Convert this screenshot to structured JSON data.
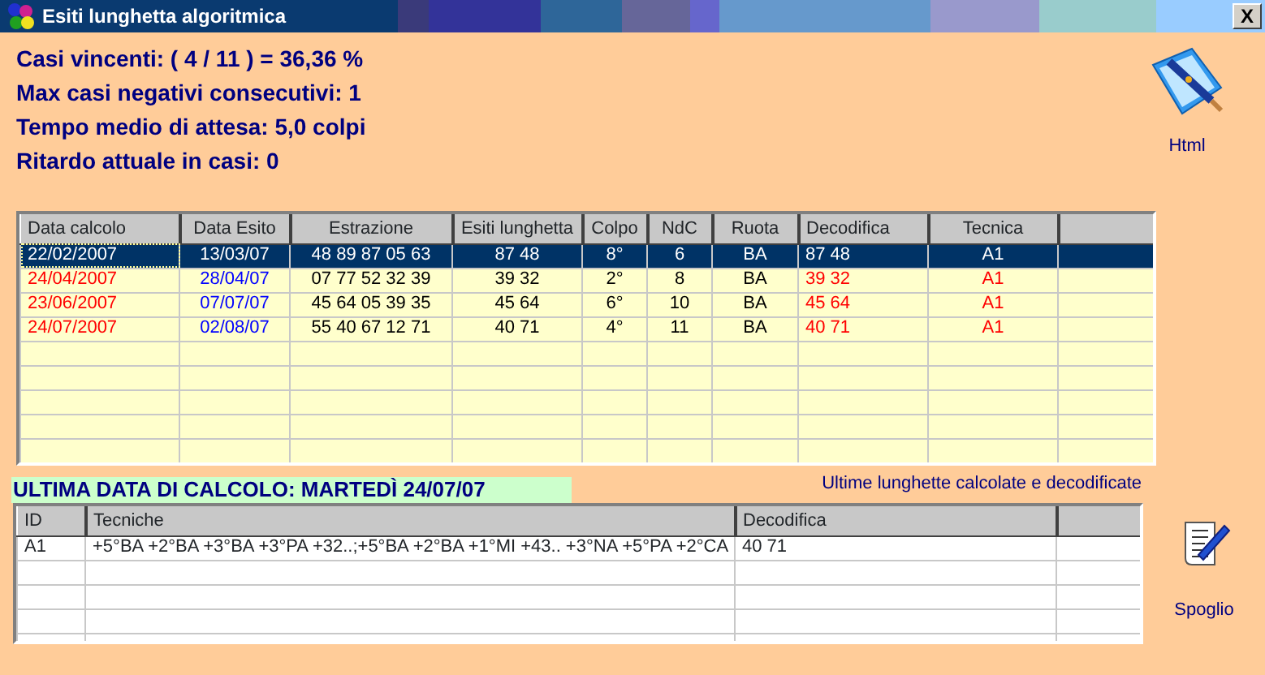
{
  "window": {
    "title": "Esiti lunghetta algoritmica",
    "close": "X"
  },
  "stats": [
    "Casi vincenti: ( 4 / 11 ) = 36,36 %",
    "Max casi negativi consecutivi: 1",
    "Tempo medio di attesa: 5,0 colpi",
    "Ritardo attuale in casi: 0"
  ],
  "html_button": {
    "label": "Html"
  },
  "results_table": {
    "columns": [
      {
        "label": "Data calcolo",
        "color": "#ff0000"
      },
      {
        "label": "Data Esito",
        "color": "#0000ff"
      },
      {
        "label": "Estrazione",
        "color": "#000000"
      },
      {
        "label": "Esiti lunghetta",
        "color": "#000000"
      },
      {
        "label": "Colpo",
        "color": "#000000"
      },
      {
        "label": "NdC",
        "color": "#000000"
      },
      {
        "label": "Ruota",
        "color": "#000000"
      },
      {
        "label": "Decodifica",
        "color": "#ff0000"
      },
      {
        "label": "Tecnica",
        "color": "#ff0000"
      }
    ],
    "rows": [
      {
        "selected": true,
        "cells": [
          "22/02/2007",
          "13/03/07",
          "48 89 87 05 63",
          "87 48",
          "8°",
          "6",
          "BA",
          "87 48",
          "A1"
        ]
      },
      {
        "selected": false,
        "cells": [
          "24/04/2007",
          "28/04/07",
          "07 77 52 32 39",
          "39 32",
          "2°",
          "8",
          "BA",
          "39 32",
          "A1"
        ]
      },
      {
        "selected": false,
        "cells": [
          "23/06/2007",
          "07/07/07",
          "45 64 05 39 35",
          "45 64",
          "6°",
          "10",
          "BA",
          "45 64",
          "A1"
        ]
      },
      {
        "selected": false,
        "cells": [
          "24/07/2007",
          "02/08/07",
          "55 40 67 12 71",
          "40 71",
          "4°",
          "11",
          "BA",
          "40 71",
          "A1"
        ]
      }
    ]
  },
  "last_date": "ULTIMA DATA DI CALCOLO: MARTEDÌ 24/07/07",
  "last_caption": "Ultime lunghette calcolate e decodificate",
  "techniques_table": {
    "columns": [
      "ID",
      "Tecniche",
      "Decodifica"
    ],
    "rows": [
      [
        "A1",
        "+5°BA +2°BA +3°BA +3°PA +32..;+5°BA +2°BA +1°MI +43.. +3°NA +5°PA +2°CA",
        "40 71"
      ]
    ]
  },
  "spoglio_button": {
    "label": "Spoglio"
  }
}
